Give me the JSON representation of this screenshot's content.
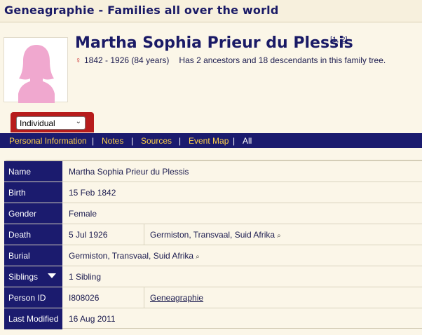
{
  "site": {
    "title": "Geneagraphie - Families all over the world"
  },
  "person": {
    "name": "Martha Sophia Prieur du Plessis",
    "refs_open": "[",
    "ref1": "1",
    "ref_sep": ", ",
    "ref2": "2",
    "refs_close": "]",
    "gender_symbol": "♀",
    "lifespan": "1842 - 1926  (84 years)",
    "summary": "Has 2 ancestors and 18 descendants in this family tree."
  },
  "selector": {
    "value": "Individual"
  },
  "tabs": [
    {
      "label": "Personal Information"
    },
    {
      "label": "Notes"
    },
    {
      "label": "Sources"
    },
    {
      "label": "Event Map"
    },
    {
      "label": "All"
    }
  ],
  "tab_separator": "|",
  "details": {
    "name": {
      "label": "Name",
      "value": "Martha Sophia Prieur du Plessis"
    },
    "birth": {
      "label": "Birth",
      "value": "15 Feb 1842"
    },
    "gender": {
      "label": "Gender",
      "value": "Female"
    },
    "death": {
      "label": "Death",
      "date": "5 Jul 1926",
      "place": "Germiston, Transvaal, Suid Afrika"
    },
    "burial": {
      "label": "Burial",
      "place": "Germiston, Transvaal, Suid Afrika"
    },
    "siblings": {
      "label": "Siblings",
      "value": "1 Sibling"
    },
    "person_id": {
      "label": "Person ID",
      "value": "I808026",
      "tree": "Geneagraphie"
    },
    "last_modified": {
      "label": "Last Modified",
      "value": "16 Aug 2011"
    }
  },
  "icons": {
    "place_search": "⌕"
  },
  "colors": {
    "nav_bg": "#1b1b6e",
    "tab_text": "#ffd24a",
    "selector_bg": "#b71c1c",
    "avatar_silhouette": "#f0a8cf"
  }
}
